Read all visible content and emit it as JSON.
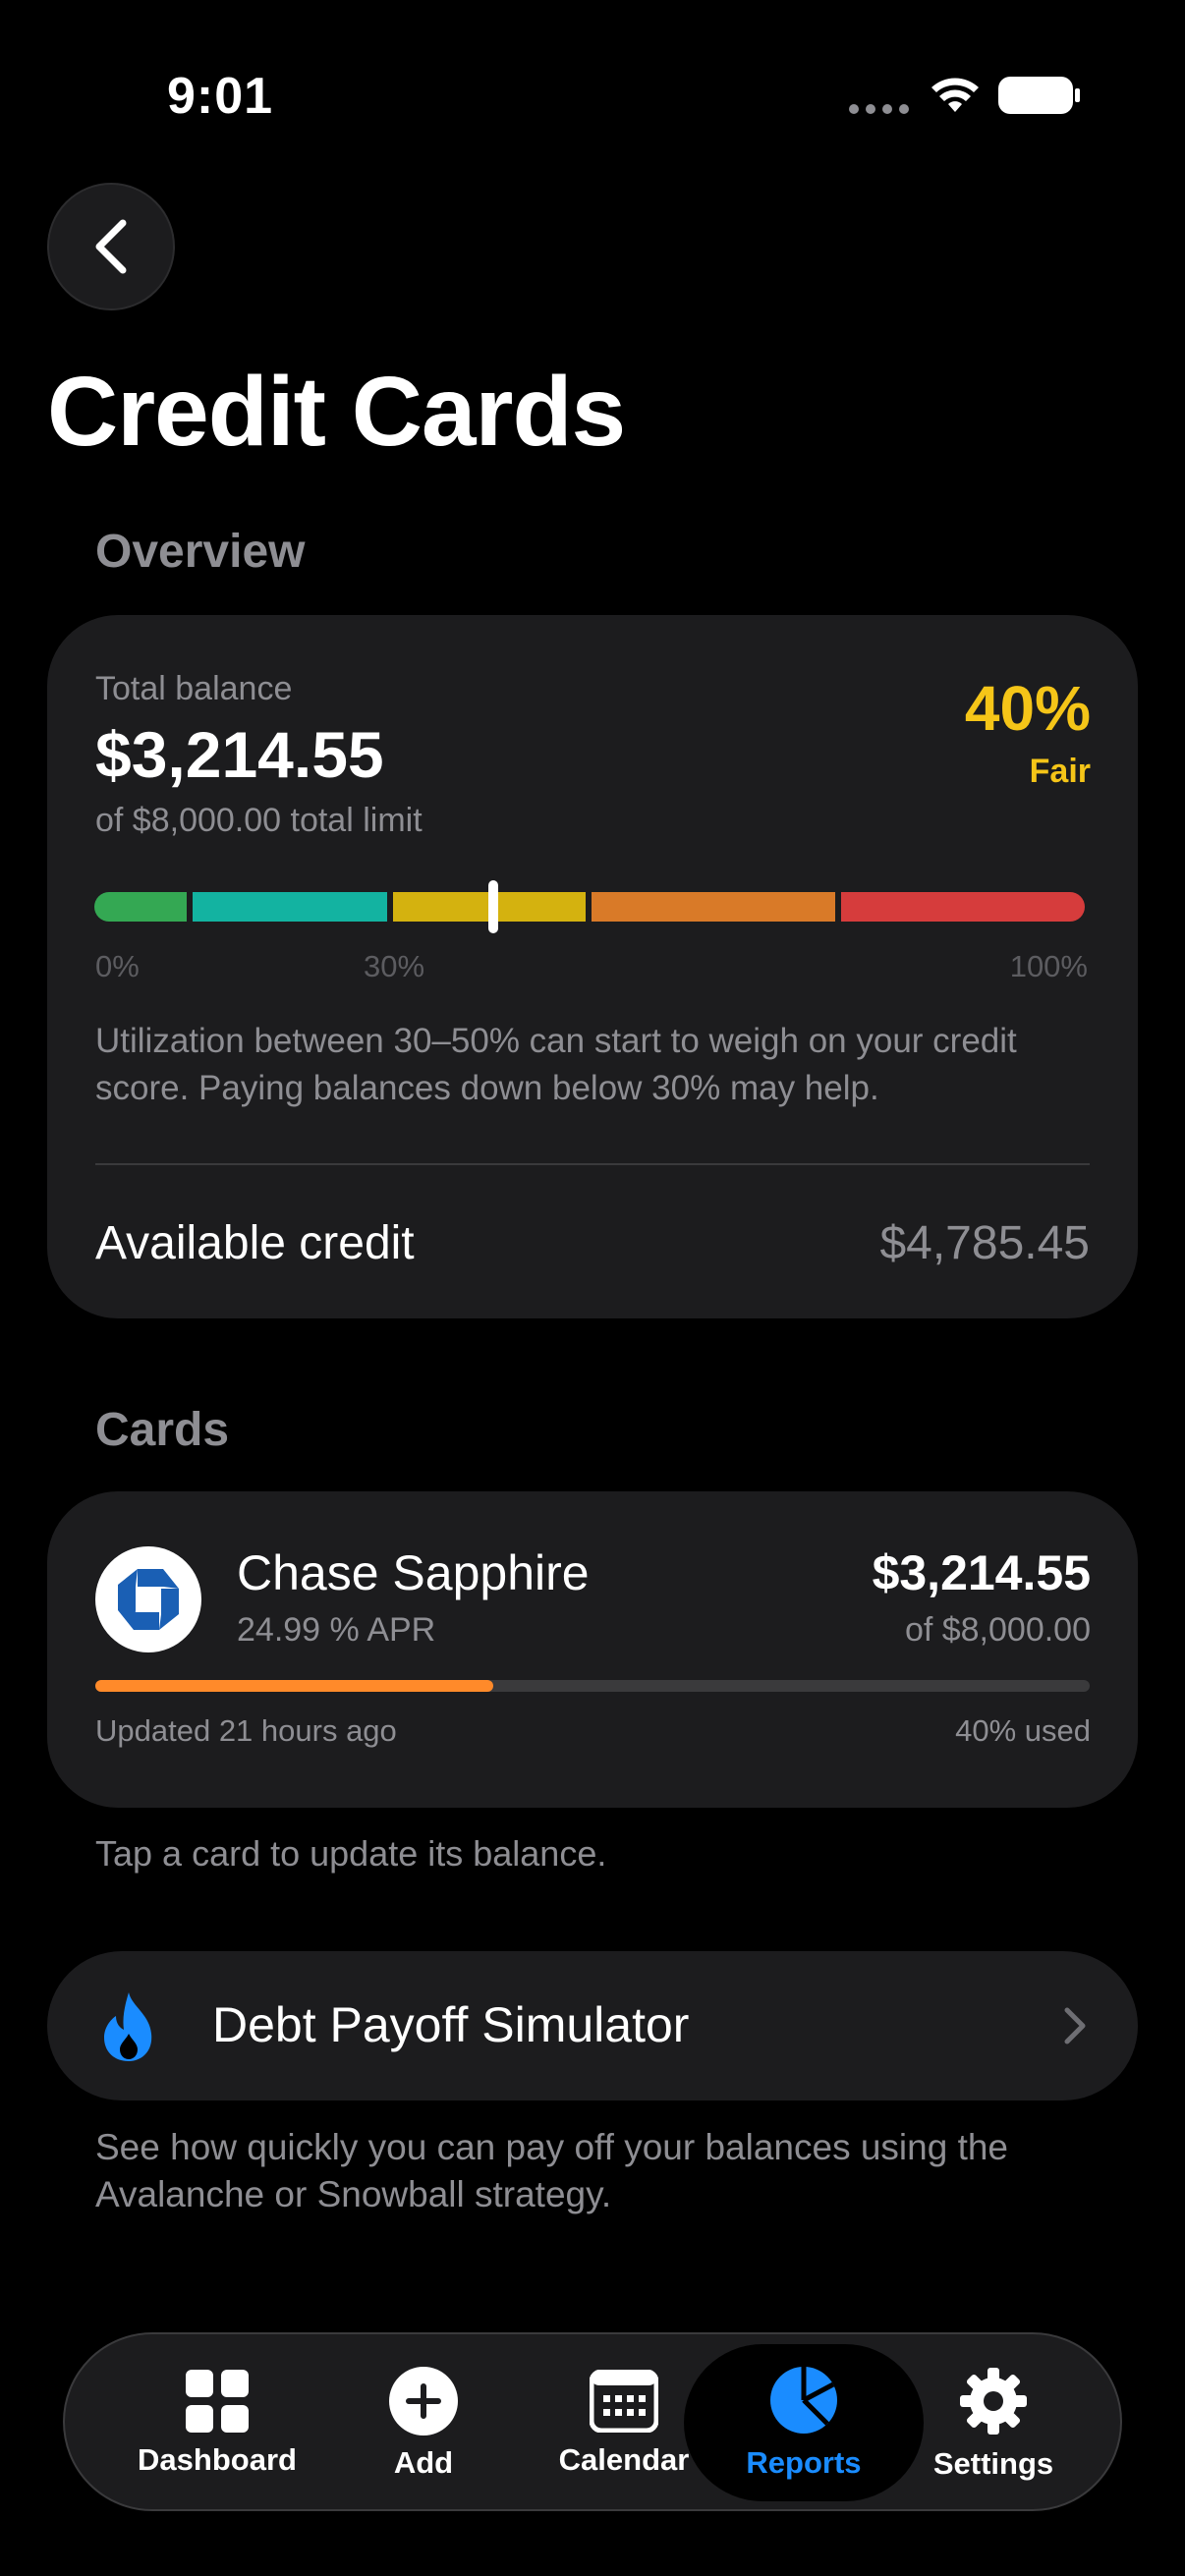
{
  "status_bar": {
    "time": "9:01"
  },
  "header": {
    "title": "Credit Cards"
  },
  "overview": {
    "section_label": "Overview",
    "total_balance_label": "Total balance",
    "total_balance": "$3,214.55",
    "limit_text": "of $8,000.00 total limit",
    "utilization_percent": "40%",
    "utilization_rating": "Fair",
    "utilization_value": 0.4,
    "scale_labels": [
      "0%",
      "30%",
      "100%"
    ],
    "advice": "Utilization between 30–50% can start to weigh on your credit score. Paying balances down below 30% may help.",
    "available_credit_label": "Available credit",
    "available_credit": "$4,785.45",
    "colors": {
      "green": "#34a853",
      "teal": "#13b3a1",
      "yellow": "#d4b20f",
      "orange": "#d97a28",
      "red": "#d63c3c",
      "rating": "#f5c518"
    }
  },
  "cards": {
    "section_label": "Cards",
    "items": [
      {
        "name": "Chase Sapphire",
        "apr": "24.99 % APR",
        "balance": "$3,214.55",
        "limit": "of $8,000.00",
        "updated": "Updated 21 hours ago",
        "used": "40% used",
        "used_fraction": 0.4,
        "icon": "chase-logo-icon"
      }
    ],
    "hint": "Tap a card to update its balance."
  },
  "simulator": {
    "label": "Debt Payoff Simulator",
    "description": "See how quickly you can pay off your balances using the Avalanche or Snowball strategy.",
    "icon": "flame-icon"
  },
  "tabbar": {
    "items": [
      {
        "label": "Dashboard",
        "icon": "grid-icon"
      },
      {
        "label": "Add",
        "icon": "plus-circle-icon"
      },
      {
        "label": "Calendar",
        "icon": "calendar-icon"
      },
      {
        "label": "Reports",
        "icon": "pie-chart-icon",
        "active": true
      },
      {
        "label": "Settings",
        "icon": "gear-icon"
      }
    ],
    "active_color": "#1a8cff"
  }
}
